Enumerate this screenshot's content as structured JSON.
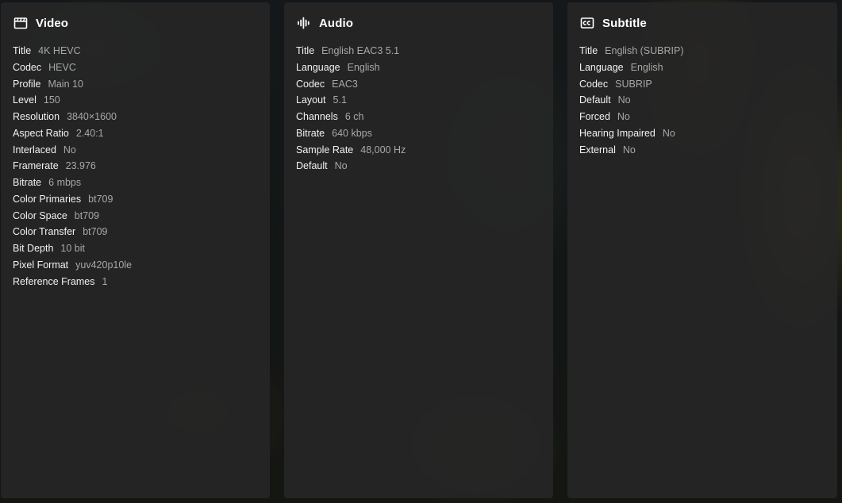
{
  "panels": {
    "video": {
      "title": "Video",
      "icon": "clapperboard-icon",
      "rows": [
        {
          "label": "Title",
          "value": "4K HEVC"
        },
        {
          "label": "Codec",
          "value": "HEVC"
        },
        {
          "label": "Profile",
          "value": "Main 10"
        },
        {
          "label": "Level",
          "value": "150"
        },
        {
          "label": "Resolution",
          "value": "3840×1600"
        },
        {
          "label": "Aspect Ratio",
          "value": "2.40:1"
        },
        {
          "label": "Interlaced",
          "value": "No"
        },
        {
          "label": "Framerate",
          "value": "23.976"
        },
        {
          "label": "Bitrate",
          "value": "6 mbps"
        },
        {
          "label": "Color Primaries",
          "value": "bt709"
        },
        {
          "label": "Color Space",
          "value": "bt709"
        },
        {
          "label": "Color Transfer",
          "value": "bt709"
        },
        {
          "label": "Bit Depth",
          "value": "10 bit"
        },
        {
          "label": "Pixel Format",
          "value": "yuv420p10le"
        },
        {
          "label": "Reference Frames",
          "value": "1"
        }
      ]
    },
    "audio": {
      "title": "Audio",
      "icon": "audio-waveform-icon",
      "rows": [
        {
          "label": "Title",
          "value": "English EAC3 5.1"
        },
        {
          "label": "Language",
          "value": "English"
        },
        {
          "label": "Codec",
          "value": "EAC3"
        },
        {
          "label": "Layout",
          "value": "5.1"
        },
        {
          "label": "Channels",
          "value": "6 ch"
        },
        {
          "label": "Bitrate",
          "value": "640 kbps"
        },
        {
          "label": "Sample Rate",
          "value": "48,000 Hz"
        },
        {
          "label": "Default",
          "value": "No"
        }
      ]
    },
    "subtitle": {
      "title": "Subtitle",
      "icon": "closed-captions-icon",
      "rows": [
        {
          "label": "Title",
          "value": "English (SUBRIP)"
        },
        {
          "label": "Language",
          "value": "English"
        },
        {
          "label": "Codec",
          "value": "SUBRIP"
        },
        {
          "label": "Default",
          "value": "No"
        },
        {
          "label": "Forced",
          "value": "No"
        },
        {
          "label": "Hearing Impaired",
          "value": "No"
        },
        {
          "label": "External",
          "value": "No"
        }
      ]
    }
  },
  "colors": {
    "panel_bg": "#262626",
    "label": "#f2f2f2",
    "value": "#a8a8a8",
    "title": "#ffffff"
  }
}
